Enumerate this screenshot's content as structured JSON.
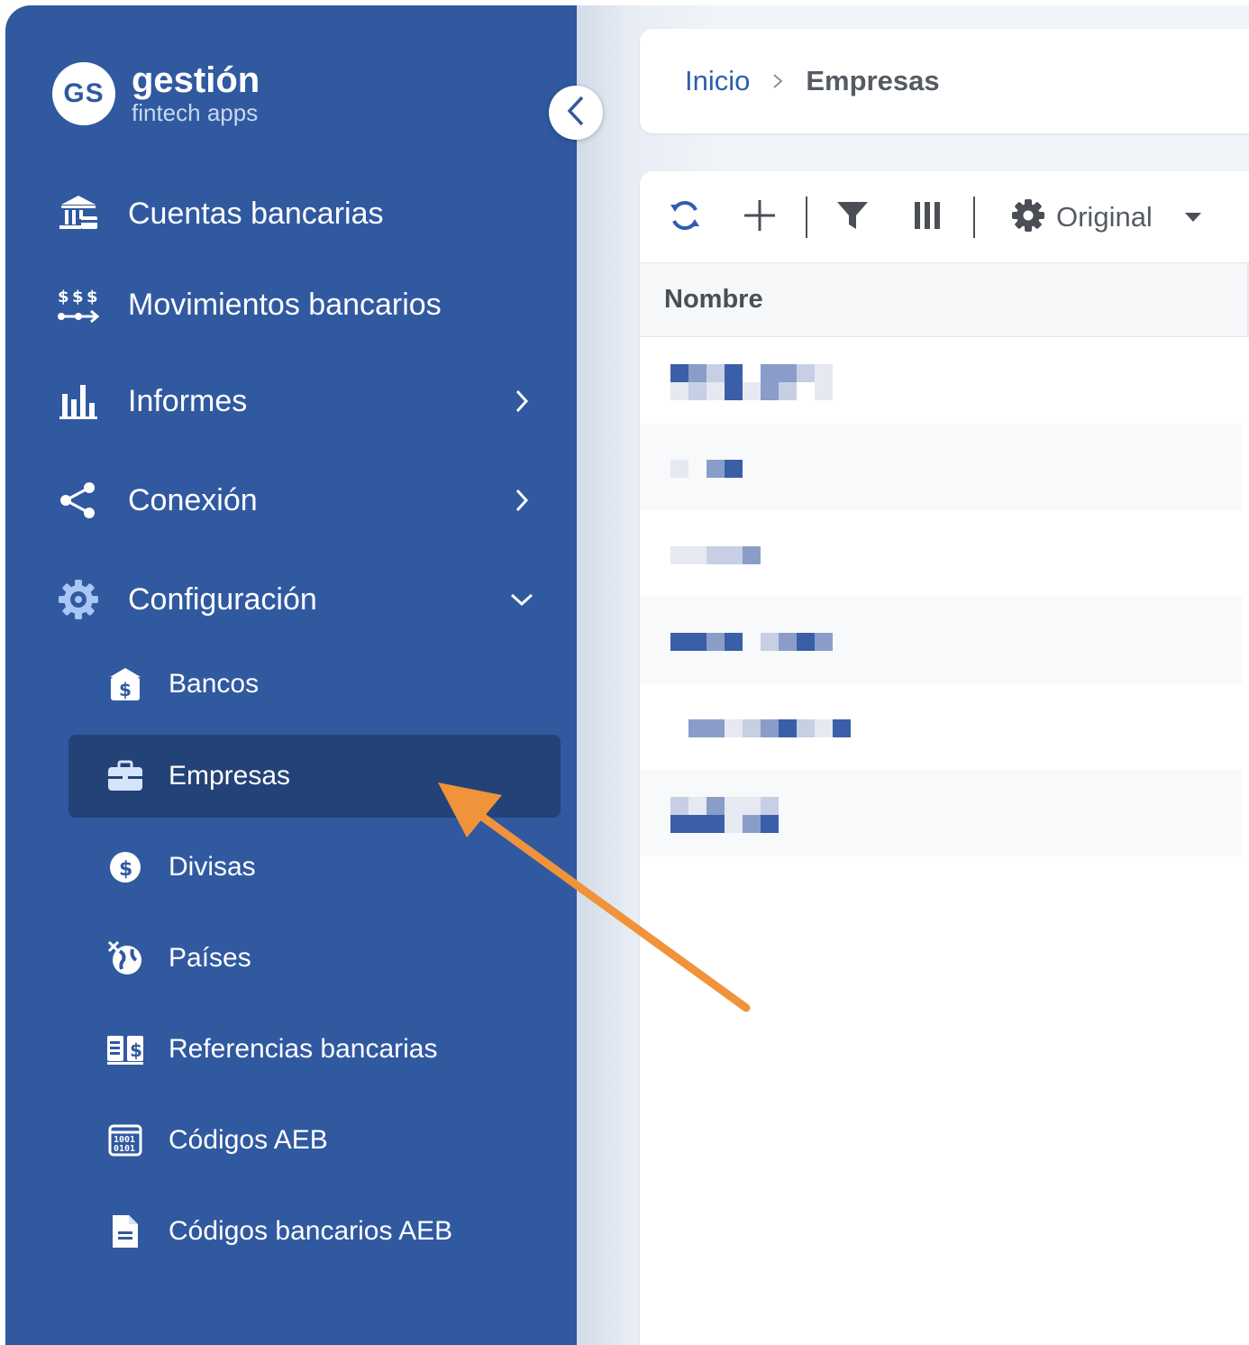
{
  "brand": {
    "logo_initials": "GS",
    "title": "gestión",
    "subtitle": "fintech apps"
  },
  "sidebar": {
    "items": [
      {
        "label": "Cuentas bancarias",
        "icon": "bank-icon"
      },
      {
        "label": "Movimientos bancarios",
        "icon": "money-transfer-icon"
      },
      {
        "label": "Informes",
        "icon": "bar-chart-icon",
        "chevron": "right"
      },
      {
        "label": "Conexión",
        "icon": "share-nodes-icon",
        "chevron": "right"
      },
      {
        "label": "Configuración",
        "icon": "gear-icon",
        "chevron": "down",
        "expanded": true
      }
    ],
    "sub_items": [
      {
        "label": "Bancos",
        "icon": "bank-dollar-icon"
      },
      {
        "label": "Empresas",
        "icon": "briefcase-icon",
        "active": true
      },
      {
        "label": "Divisas",
        "icon": "dollar-circle-icon"
      },
      {
        "label": "Países",
        "icon": "globe-icon"
      },
      {
        "label": "Referencias bancarias",
        "icon": "book-dollar-icon"
      },
      {
        "label": "Códigos AEB",
        "icon": "binary-code-icon"
      },
      {
        "label": "Códigos bancarios AEB",
        "icon": "document-icon"
      }
    ]
  },
  "breadcrumb": {
    "home": "Inicio",
    "current": "Empresas"
  },
  "toolbar": {
    "view_select": "Original"
  },
  "table": {
    "columns": [
      "Nombre"
    ],
    "row_count_visible": 6
  },
  "colors": {
    "sidebar_bg": "#3059a0",
    "sidebar_active": "#234278",
    "link": "#2f5db0",
    "annotation_arrow": "#f0933a"
  }
}
